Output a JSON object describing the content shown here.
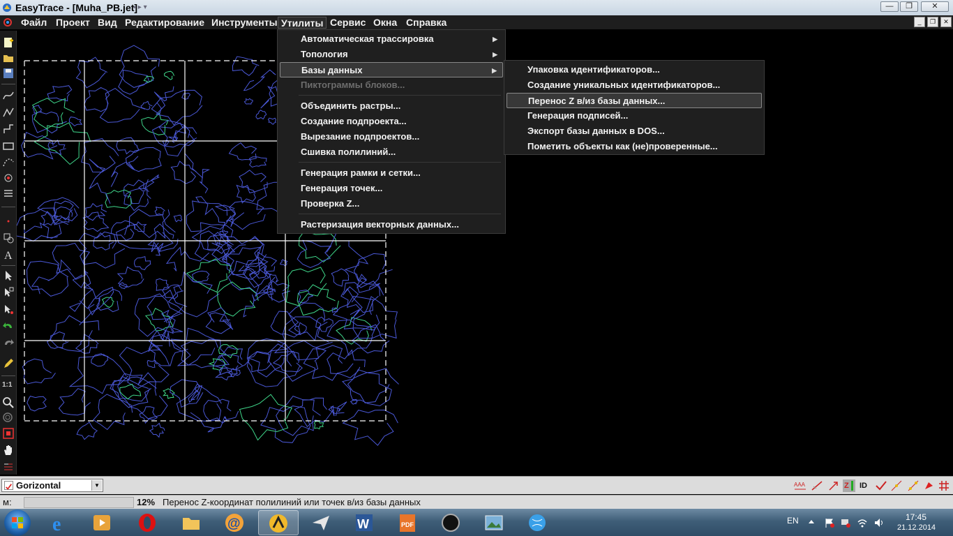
{
  "window": {
    "title": "EasyTrace - [Muha_PB.jet]",
    "caption_controls": {
      "minimize": "—",
      "restore": "❐",
      "close": "✕"
    }
  },
  "menubar": {
    "items": [
      "Файл",
      "Проект",
      "Вид",
      "Редактирование",
      "Инструменты",
      "Утилиты",
      "Сервис",
      "Окна",
      "Справка"
    ],
    "active": "Утилиты"
  },
  "utilities_menu": {
    "items": [
      {
        "label": "Автоматическая трассировка",
        "submenu": true
      },
      {
        "label": "Топология",
        "submenu": true
      },
      {
        "label": "Базы данных",
        "submenu": true,
        "highlighted": true
      },
      {
        "label": "Пиктограммы блоков...",
        "disabled": true
      },
      {
        "label": "Объединить растры..."
      },
      {
        "label": "Создание подпроекта..."
      },
      {
        "label": "Вырезание подпроектов..."
      },
      {
        "label": "Сшивка полилиний..."
      },
      {
        "label": "Генерация рамки и сетки..."
      },
      {
        "label": "Генерация точек..."
      },
      {
        "label": "Проверка Z..."
      },
      {
        "label": "Растеризация векторных данных..."
      }
    ],
    "submenu_arrow": "▶"
  },
  "database_submenu": {
    "items": [
      {
        "label": "Упаковка идентификаторов..."
      },
      {
        "label": "Создание уникальных идентификаторов..."
      },
      {
        "label": "Перенос Z в/из базы данных...",
        "highlighted": true
      },
      {
        "label": "Генерация подписей..."
      },
      {
        "label": "Экспорт базы данных в DOS..."
      },
      {
        "label": "Пометить объекты как (не)проверенные..."
      }
    ]
  },
  "layer_combo": {
    "value": "Gorizontal",
    "drop_arrow": "▼"
  },
  "statusbar": {
    "mode": "м:",
    "zoom": "12%",
    "message": "Перенос Z-координат полилиний или точек в/из базы данных"
  },
  "left_toolbar": {
    "scale_label": "1:1"
  },
  "bottom_toolbar": {
    "id_label": "ID"
  },
  "tray": {
    "language": "EN",
    "time": "17:45",
    "date": "21.12.2014"
  },
  "colors": {
    "contour": "#4a58d6",
    "grid": "#ffffff",
    "accent_green": "#3fd68a",
    "menu_bg": "#1f1f1f"
  }
}
